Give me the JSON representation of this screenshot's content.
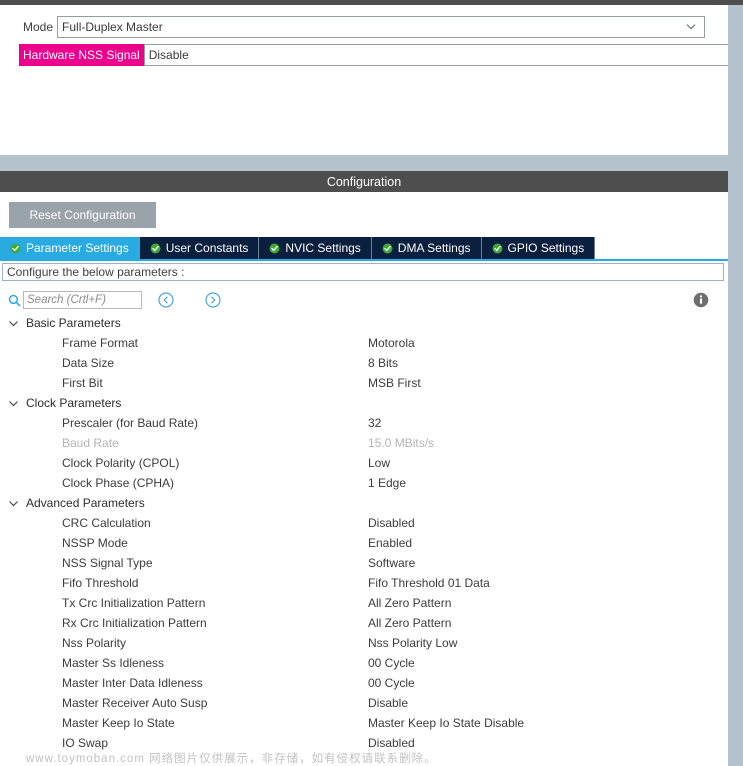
{
  "window": {
    "config_title": "Configuration"
  },
  "mode_panel": {
    "fields": [
      {
        "label": "Mode",
        "value": "Full-Duplex Master",
        "highlighted": false,
        "name": "mode"
      },
      {
        "label": "Hardware NSS Signal",
        "value": "Disable",
        "highlighted": true,
        "name": "hardware-nss-signal"
      }
    ],
    "highlight_color": "#ec008c"
  },
  "toolbar": {
    "reset_label": "Reset Configuration"
  },
  "tabs": [
    {
      "label": "Parameter Settings",
      "active": true,
      "icon": "check-circle-icon"
    },
    {
      "label": "User Constants",
      "active": false,
      "icon": "check-circle-icon"
    },
    {
      "label": "NVIC Settings",
      "active": false,
      "icon": "check-circle-icon"
    },
    {
      "label": "DMA Settings",
      "active": false,
      "icon": "check-circle-icon"
    },
    {
      "label": "GPIO Settings",
      "active": false,
      "icon": "check-circle-icon"
    }
  ],
  "configure_bar": {
    "text": "Configure the below parameters :"
  },
  "search": {
    "placeholder": "Search (Crtl+F)",
    "value": "",
    "prev_icon": "chevron-left-circle-icon",
    "next_icon": "chevron-right-circle-icon",
    "search_icon": "magnifier-icon",
    "info_icon": "info-icon"
  },
  "parameters": [
    {
      "group": "Basic Parameters",
      "expanded": true,
      "rows": [
        {
          "name": "Frame Format",
          "value": "Motorola",
          "disabled": false
        },
        {
          "name": "Data Size",
          "value": "8 Bits",
          "disabled": false
        },
        {
          "name": "First Bit",
          "value": "MSB First",
          "disabled": false
        }
      ]
    },
    {
      "group": "Clock Parameters",
      "expanded": true,
      "rows": [
        {
          "name": "Prescaler (for Baud Rate)",
          "value": "32",
          "disabled": false
        },
        {
          "name": "Baud Rate",
          "value": "15.0 MBits/s",
          "disabled": true
        },
        {
          "name": "Clock Polarity (CPOL)",
          "value": "Low",
          "disabled": false
        },
        {
          "name": "Clock Phase (CPHA)",
          "value": "1 Edge",
          "disabled": false
        }
      ]
    },
    {
      "group": "Advanced Parameters",
      "expanded": true,
      "rows": [
        {
          "name": "CRC Calculation",
          "value": "Disabled",
          "disabled": false
        },
        {
          "name": "NSSP Mode",
          "value": "Enabled",
          "disabled": false
        },
        {
          "name": "NSS Signal Type",
          "value": "Software",
          "disabled": false
        },
        {
          "name": "Fifo Threshold",
          "value": "Fifo Threshold 01 Data",
          "disabled": false
        },
        {
          "name": "Tx Crc Initialization Pattern",
          "value": "All Zero Pattern",
          "disabled": false
        },
        {
          "name": "Rx Crc Initialization Pattern",
          "value": "All Zero Pattern",
          "disabled": false
        },
        {
          "name": "Nss Polarity",
          "value": "Nss Polarity Low",
          "disabled": false
        },
        {
          "name": "Master Ss Idleness",
          "value": "00 Cycle",
          "disabled": false
        },
        {
          "name": "Master Inter Data Idleness",
          "value": "00 Cycle",
          "disabled": false
        },
        {
          "name": "Master Receiver Auto Susp",
          "value": "Disable",
          "disabled": false
        },
        {
          "name": "Master Keep Io State",
          "value": "Master Keep Io State Disable",
          "disabled": false
        },
        {
          "name": "IO Swap",
          "value": "Disabled",
          "disabled": false
        }
      ]
    }
  ],
  "watermark": {
    "text": "www.toymoban.com 网络图片仅供展示，非存储，如有侵权请联系删除。"
  },
  "colors": {
    "accent_blue": "#29abe2",
    "tab_dark": "#0b1f3f",
    "title_bar": "#4e4e4e",
    "rail": "#b4c2cd",
    "highlight_pink": "#ec008c"
  }
}
